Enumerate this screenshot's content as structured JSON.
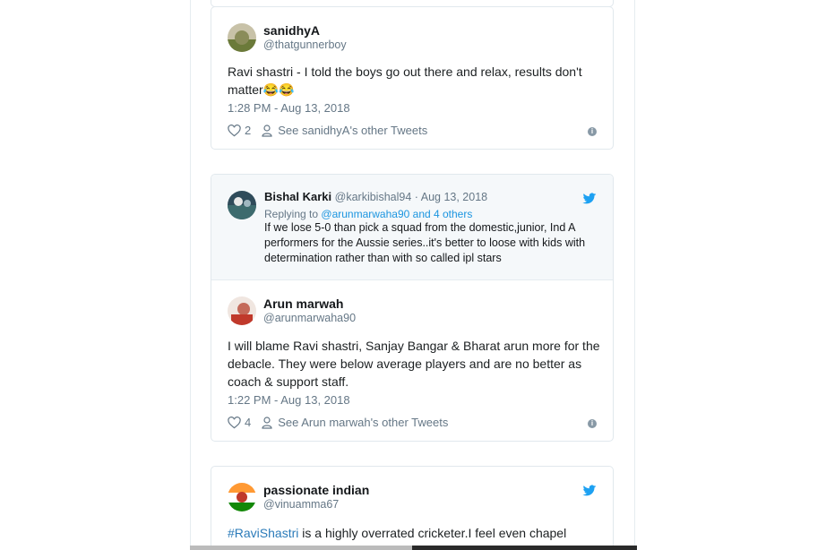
{
  "tweets": [
    {
      "name": "sanidhyA",
      "handle": "@thatgunnerboy",
      "text": "Ravi shastri - I told the boys go out there and relax, results don't matter😂😂",
      "time": "1:28 PM - Aug 13, 2018",
      "likes": "2",
      "see_more": "See sanidhyA's other Tweets"
    },
    {
      "quoted": {
        "name": "Bishal Karki",
        "handle": "@karkibishal94",
        "date": "· Aug 13, 2018",
        "replying_prefix": "Replying to",
        "replying_to": "@arunmarwaha90",
        "replying_suffix": "and 4 others",
        "text": "If we lose 5-0 than pick a squad from the domestic,junior, Ind A performers for the Aussie series..it's better to loose with kids with determination rather than with so called ipl stars"
      },
      "name": "Arun marwah",
      "handle": "@arunmarwaha90",
      "text": "I will blame Ravi shastri, Sanjay Bangar & Bharat arun more for the debacle. They were below average players and are no better as coach & support staff.",
      "time": "1:22 PM - Aug 13, 2018",
      "likes": "4",
      "see_more": "See Arun marwah's other Tweets"
    },
    {
      "name": "passionate indian",
      "handle": "@vinuamma67",
      "hashtag": "#RaviShastri",
      "text": " is a highly overrated cricketer.I feel even chapel"
    }
  ],
  "colors": {
    "twitter_blue": "#1da1f2",
    "link": "#2b7bb9",
    "secondary": "#657786"
  }
}
